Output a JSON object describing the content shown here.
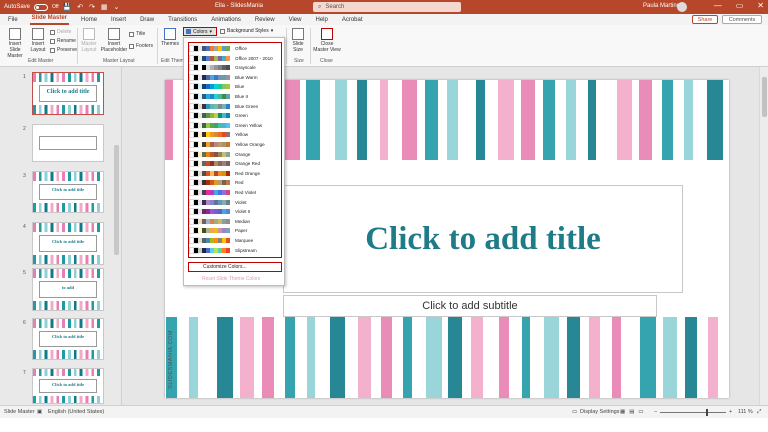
{
  "titlebar": {
    "autosave_label": "AutoSave",
    "autosave_state": "Off",
    "quick_access": "💾 ↶ ↷ ▦ ⌄",
    "doc_title": "Ella - SlidesMania",
    "search_placeholder": "Search",
    "user_name": "Paula Martinez",
    "window_buttons": [
      "—",
      "▭",
      "✕"
    ]
  },
  "menu": {
    "tabs": [
      "File",
      "Slide Master",
      "Home",
      "Insert",
      "Draw",
      "Transitions",
      "Animations",
      "Review",
      "View",
      "Help",
      "Acrobat"
    ],
    "active_tab": "Slide Master",
    "share_label": "Share",
    "comments_label": "Comments"
  },
  "ribbon": {
    "insert_slide_master": "Insert Slide Master",
    "insert_layout": "Insert Layout",
    "delete": "Delete",
    "rename": "Rename",
    "preserve": "Preserve",
    "master_layout": "Master Layout",
    "insert_placeholder": "Insert Placeholder",
    "title_checkbox": "Title",
    "footers_checkbox": "Footers",
    "themes": "Themes",
    "colors": "Colors",
    "background_styles": "Background Styles",
    "slide_size": "Slide Size",
    "close_master_view": "Close Master View",
    "groups": [
      "Edit Master",
      "Master Layout",
      "Edit Theme",
      "Size",
      "Close"
    ]
  },
  "dropdown": {
    "palettes": [
      {
        "name": "Office",
        "colors": [
          "#ffffff",
          "#000000",
          "#e7e6e6",
          "#44546a",
          "#4472c4",
          "#ed7d31",
          "#a5a5a5",
          "#ffc000",
          "#5b9bd5",
          "#70ad47"
        ]
      },
      {
        "name": "Office 2007 - 2010",
        "colors": [
          "#ffffff",
          "#000000",
          "#eeece1",
          "#1f497d",
          "#4f81bd",
          "#c0504d",
          "#9bbb59",
          "#8064a2",
          "#4bacc6",
          "#f79646"
        ]
      },
      {
        "name": "Grayscale",
        "colors": [
          "#ffffff",
          "#000000",
          "#f8f8f8",
          "#000000",
          "#dddddd",
          "#b2b2b2",
          "#969696",
          "#808080",
          "#5f5f5f",
          "#4d4d4d"
        ]
      },
      {
        "name": "Blue Warm",
        "colors": [
          "#ffffff",
          "#000000",
          "#e7e6e6",
          "#242852",
          "#4a66ac",
          "#629dd1",
          "#297fd5",
          "#7f8fa9",
          "#5aa2ae",
          "#9d90a0"
        ]
      },
      {
        "name": "Blue",
        "colors": [
          "#ffffff",
          "#000000",
          "#dbeef4",
          "#17406d",
          "#0f6fc6",
          "#009dd9",
          "#0bd0d9",
          "#10cf9b",
          "#7cca62",
          "#a5c249"
        ]
      },
      {
        "name": "Blue II",
        "colors": [
          "#ffffff",
          "#000000",
          "#dbf5f9",
          "#335b74",
          "#1cade4",
          "#2683c6",
          "#27ced7",
          "#42ba97",
          "#3e8853",
          "#62a39f"
        ]
      },
      {
        "name": "Blue Green",
        "colors": [
          "#ffffff",
          "#000000",
          "#e3ded1",
          "#373545",
          "#3494ba",
          "#58b6c0",
          "#75bda7",
          "#7a8c8e",
          "#84acb6",
          "#2683c6"
        ]
      },
      {
        "name": "Green",
        "colors": [
          "#ffffff",
          "#000000",
          "#e9e5dc",
          "#455f51",
          "#549e39",
          "#8ab833",
          "#c0cf3a",
          "#029676",
          "#4ab5c4",
          "#0989b1"
        ]
      },
      {
        "name": "Green Yellow",
        "colors": [
          "#ffffff",
          "#000000",
          "#eeece1",
          "#455f51",
          "#99cb38",
          "#63a537",
          "#37a76f",
          "#44c1a3",
          "#4eb3cf",
          "#51c3f9"
        ]
      },
      {
        "name": "Yellow",
        "colors": [
          "#ffffff",
          "#000000",
          "#fff1cf",
          "#39302a",
          "#ffca08",
          "#f8931d",
          "#ce8d3e",
          "#ec7016",
          "#e64823",
          "#9c6a6a"
        ]
      },
      {
        "name": "Yellow Orange",
        "colors": [
          "#ffffff",
          "#000000",
          "#fbf9e7",
          "#4e3b30",
          "#f0a22e",
          "#a5644e",
          "#b58b80",
          "#c3986d",
          "#a19574",
          "#c17529"
        ]
      },
      {
        "name": "Orange",
        "colors": [
          "#ffffff",
          "#000000",
          "#fbeec9",
          "#637052",
          "#e48312",
          "#bd582c",
          "#865640",
          "#9b8357",
          "#c2bc80",
          "#94a088"
        ]
      },
      {
        "name": "Orange Red",
        "colors": [
          "#ffffff",
          "#000000",
          "#f7efd7",
          "#696464",
          "#d34817",
          "#9b2d1f",
          "#a28e6a",
          "#956251",
          "#918485",
          "#855d5d"
        ]
      },
      {
        "name": "Red Orange",
        "colors": [
          "#ffffff",
          "#000000",
          "#e3ded1",
          "#505046",
          "#e84c22",
          "#ffbd47",
          "#b64926",
          "#ff8427",
          "#cc9900",
          "#b22600"
        ]
      },
      {
        "name": "Red",
        "colors": [
          "#ffffff",
          "#000000",
          "#ecd8d8",
          "#323232",
          "#a5300f",
          "#d55816",
          "#e19825",
          "#b19c7d",
          "#7f5f52",
          "#b27d49"
        ]
      },
      {
        "name": "Red Violet",
        "colors": [
          "#ffffff",
          "#000000",
          "#e6dde0",
          "#454551",
          "#e32d91",
          "#c830cc",
          "#4ea6dc",
          "#4775e7",
          "#8971e1",
          "#d54773"
        ]
      },
      {
        "name": "Violet",
        "colors": [
          "#ffffff",
          "#000000",
          "#e8dfee",
          "#373545",
          "#ad84c6",
          "#8784c7",
          "#5d739a",
          "#6997af",
          "#84acb6",
          "#6f8183"
        ]
      },
      {
        "name": "Violet II",
        "colors": [
          "#ffffff",
          "#000000",
          "#e6dcec",
          "#632e62",
          "#92278f",
          "#9b57d3",
          "#755dd9",
          "#665eb8",
          "#45a5ed",
          "#5982db"
        ]
      },
      {
        "name": "Median",
        "colors": [
          "#ffffff",
          "#000000",
          "#ebddc3",
          "#775f55",
          "#94b6d2",
          "#dd8047",
          "#a5ab81",
          "#d8b25c",
          "#7ba79d",
          "#968c8c"
        ]
      },
      {
        "name": "Paper",
        "colors": [
          "#ffffff",
          "#000000",
          "#fefac9",
          "#444d26",
          "#a5b592",
          "#f3a447",
          "#e7bc29",
          "#d092a7",
          "#9c85c0",
          "#809ec2"
        ]
      },
      {
        "name": "Marquee",
        "colors": [
          "#ffffff",
          "#000000",
          "#ddddd3",
          "#5e5e5e",
          "#418ab3",
          "#a6b727",
          "#f69200",
          "#838383",
          "#fec306",
          "#df5327"
        ]
      },
      {
        "name": "Slipstream",
        "colors": [
          "#ffffff",
          "#000000",
          "#c8c8c8",
          "#212745",
          "#4e67c8",
          "#5eccf3",
          "#a7ea52",
          "#5dceaf",
          "#ff8021",
          "#f14124"
        ]
      }
    ],
    "customize_label": "Customize Colors...",
    "reset_label": "Reset Slide Theme Colors"
  },
  "slide": {
    "title_placeholder": "Click to add title",
    "subtitle_placeholder": "Click to add subtitle",
    "watermark": "SLIDESMANIA.COM",
    "stripe_colors": [
      "#e87fb0",
      "#1f9aa6",
      "#8fd0d6",
      "#0f7a8a",
      "#f2a9c8"
    ]
  },
  "thumbnails": {
    "numbers": [
      "1",
      "2",
      "3",
      "4",
      "5",
      "6",
      "7"
    ],
    "titles": [
      "Click to add title",
      "",
      "Click to add title",
      "Click to add title",
      "to add",
      "Click to add title",
      "Click to add title"
    ]
  },
  "statusbar": {
    "view": "Slide Master",
    "language": "English (United States)",
    "display_settings": "Display Settings",
    "zoom": "111 %"
  }
}
